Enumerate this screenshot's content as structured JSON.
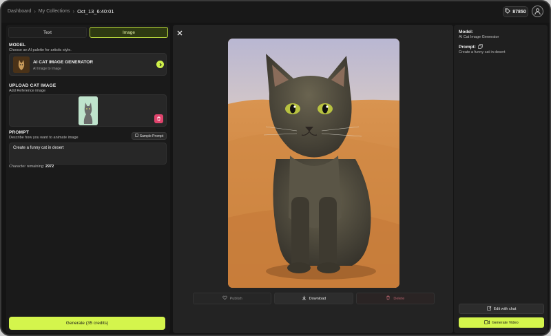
{
  "breadcrumb": {
    "items": [
      "Dashboard",
      "My Collections"
    ],
    "current": "Oct_13_6:40:01"
  },
  "header": {
    "credits": "87850",
    "credits_icon": "tag-icon",
    "avatar_icon": "user-avatar-icon"
  },
  "left_panel": {
    "tabs": [
      {
        "label": "Text",
        "active": false
      },
      {
        "label": "Image",
        "active": true
      }
    ],
    "model": {
      "title": "MODEL",
      "subtitle": "Choose an AI palette for artistic style.",
      "name": "AI CAT IMAGE GENERATOR",
      "description": "AI Image to Image"
    },
    "upload": {
      "title": "UPLOAD CAT IMAGE",
      "subtitle": "Add Reference image"
    },
    "prompt": {
      "title": "PROMPT",
      "subtitle": "Describe how you want to animate image",
      "sample_button": "Sample Prompt",
      "value": "Create a funny cat in desert",
      "char_label": "Character remaining:",
      "char_count": "2972"
    },
    "generate_button": "Generate (35 credits)"
  },
  "center_panel": {
    "actions": {
      "publish": "Publish",
      "download": "Download",
      "delete": "Delete"
    }
  },
  "right_panel": {
    "model_label": "Model:",
    "model_value": "AI Cat Image Generator",
    "prompt_label": "Prompt:",
    "prompt_value": "Create a funny cat in desert",
    "edit_button": "Edit with chat",
    "video_button": "Generate Video"
  },
  "colors": {
    "accent": "#d4f54c",
    "danger": "#e0436c",
    "background": "#141414"
  }
}
